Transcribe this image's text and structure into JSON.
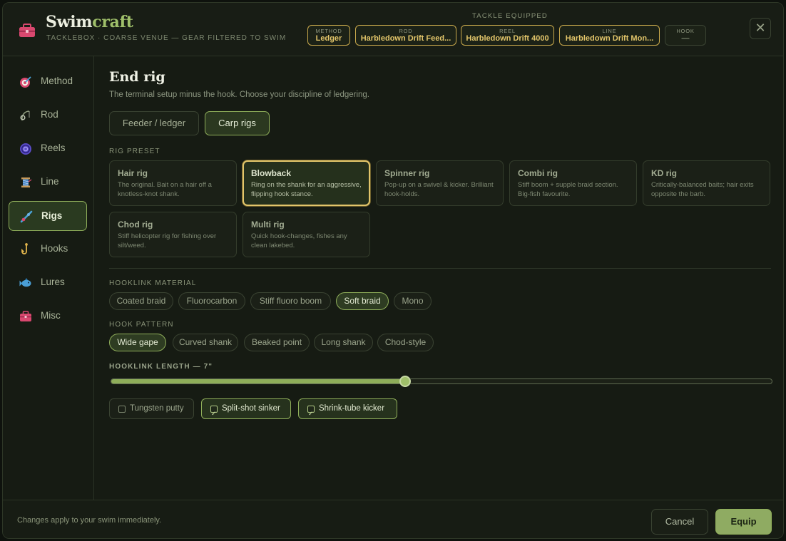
{
  "header": {
    "brand_main": "Swim",
    "brand_accent": "craft",
    "subtitle": "TACKLEBOX · COARSE VENUE — GEAR FILTERED TO SWIM",
    "equipped_title": "TACKLE EQUIPPED",
    "chips": [
      {
        "key": "METHOD",
        "value": "Ledger"
      },
      {
        "key": "ROD",
        "value": "Harbledown Drift Feed..."
      },
      {
        "key": "REEL",
        "value": "Harbledown Drift 4000"
      },
      {
        "key": "LINE",
        "value": "Harbledown Drift Mon..."
      },
      {
        "key": "HOOK",
        "value": "—"
      }
    ],
    "close_glyph": "✕"
  },
  "sidebar": {
    "items": [
      {
        "label": "Method",
        "icon": "target-icon"
      },
      {
        "label": "Rod",
        "icon": "rod-icon"
      },
      {
        "label": "Reels",
        "icon": "reel-icon"
      },
      {
        "label": "Line",
        "icon": "spool-icon"
      },
      {
        "label": "Rigs",
        "icon": "rig-icon"
      },
      {
        "label": "Hooks",
        "icon": "hook-icon"
      },
      {
        "label": "Lures",
        "icon": "fish-icon"
      },
      {
        "label": "Misc",
        "icon": "tacklebox-icon"
      }
    ],
    "active": "Rigs"
  },
  "main": {
    "title": "End rig",
    "lead": "The terminal setup minus the hook. Choose your discipline of ledgering.",
    "disciplines": [
      "Feeder / ledger",
      "Carp rigs"
    ],
    "discipline_selected": "Carp rigs",
    "rig_preset_label": "RIG PRESET",
    "presets": [
      {
        "title": "Hair rig",
        "desc": "The original. Bait on a hair off a knotless-knot shank."
      },
      {
        "title": "Blowback",
        "desc": "Ring on the shank for an aggressive, flipping hook stance."
      },
      {
        "title": "Spinner rig",
        "desc": "Pop-up on a swivel & kicker. Brilliant hook-holds."
      },
      {
        "title": "Combi rig",
        "desc": "Stiff boom + supple braid section. Big-fish favourite."
      },
      {
        "title": "KD rig",
        "desc": "Critically-balanced baits; hair exits opposite the barb."
      },
      {
        "title": "Chod rig",
        "desc": "Stiff helicopter rig for fishing over silt/weed."
      },
      {
        "title": "Multi rig",
        "desc": "Quick hook-changes, fishes any clean lakebed."
      }
    ],
    "preset_selected": "Blowback",
    "hooklink_label": "HOOKLINK MATERIAL",
    "hooklinks": [
      "Coated braid",
      "Fluorocarbon",
      "Stiff fluoro boom",
      "Soft braid",
      "Mono"
    ],
    "hooklink_selected": "Soft braid",
    "pattern_label": "HOOK PATTERN",
    "patterns": [
      "Wide gape",
      "Curved shank",
      "Beaked point",
      "Long shank",
      "Chod-style"
    ],
    "pattern_selected": "Wide gape",
    "length_label": "HOOKLINK LENGTH — 7\"",
    "length_fraction": 0.445,
    "extras": [
      {
        "label": "Tungsten putty",
        "checked": false
      },
      {
        "label": "Split-shot sinker",
        "checked": true
      },
      {
        "label": "Shrink-tube kicker",
        "checked": true
      }
    ]
  },
  "footer": {
    "note": "Changes apply to your swim immediately.",
    "cancel": "Cancel",
    "equip": "Equip"
  },
  "colors": {
    "accent_green": "#8fae5a",
    "accent_gold": "#e2c56a",
    "background": "#161b13"
  }
}
